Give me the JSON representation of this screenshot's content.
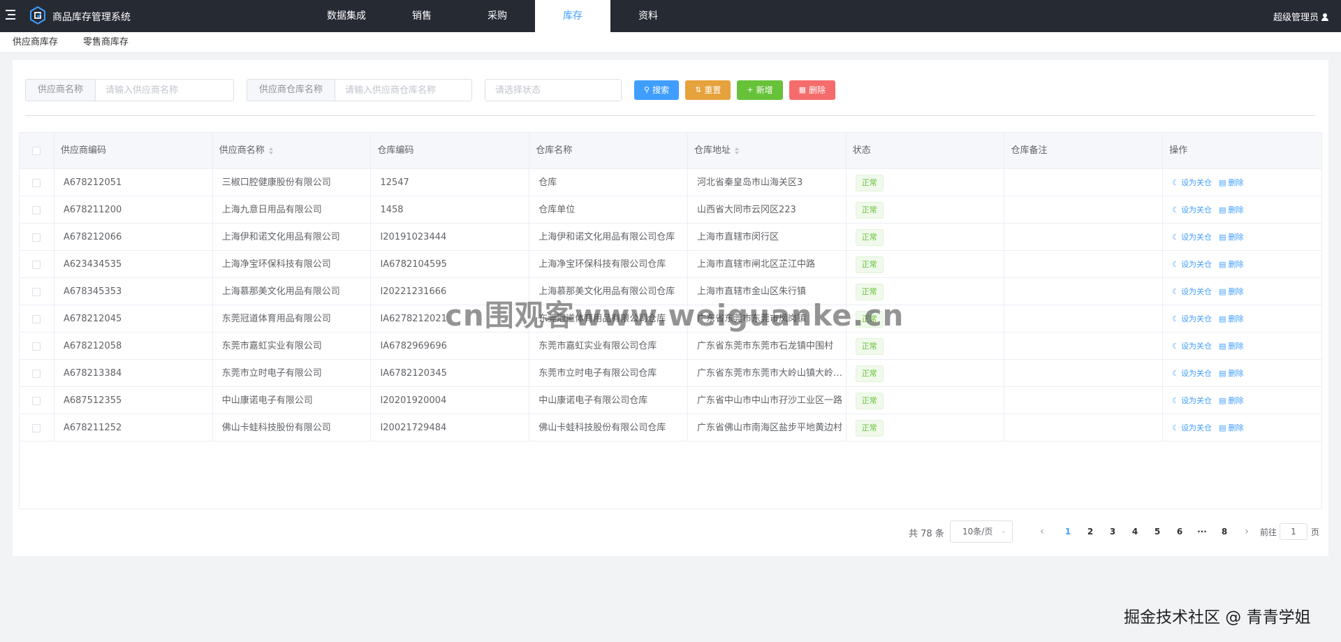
{
  "app": {
    "title": "商品库存管理系统"
  },
  "nav": {
    "items": [
      {
        "label": "数据集成",
        "active": false
      },
      {
        "label": "销售",
        "active": false
      },
      {
        "label": "采购",
        "active": false
      },
      {
        "label": "库存",
        "active": true
      },
      {
        "label": "资料",
        "active": false
      }
    ]
  },
  "user": {
    "name": "超级管理员"
  },
  "subtabs": [
    {
      "label": "供应商库存"
    },
    {
      "label": "零售商库存"
    }
  ],
  "filter": {
    "supplier_name_label": "供应商名称",
    "supplier_name_placeholder": "请输入供应商名称",
    "warehouse_name_label": "供应商仓库名称",
    "warehouse_name_placeholder": "请输入供应商仓库名称",
    "status_placeholder": "请选择状态",
    "search_label": "搜索",
    "reset_label": "重置",
    "add_label": "新增",
    "delete_label": "删除"
  },
  "table": {
    "headers": [
      "供应商编码",
      "供应商名称",
      "仓库编码",
      "仓库名称",
      "仓库地址",
      "状态",
      "仓库备注",
      "操作"
    ],
    "rows": [
      {
        "code": "A678212051",
        "name": "三椒口腔健康股份有限公司",
        "wh_code": "12547",
        "wh_name": "仓库",
        "address": "河北省秦皇岛市山海关区3",
        "status": "正常",
        "remark": ""
      },
      {
        "code": "A678211200",
        "name": "上海九意日用品有限公司",
        "wh_code": "1458",
        "wh_name": "仓库单位",
        "address": "山西省大同市云冈区223",
        "status": "正常",
        "remark": ""
      },
      {
        "code": "A678212066",
        "name": "上海伊和诺文化用品有限公司",
        "wh_code": "I20191023444",
        "wh_name": "上海伊和诺文化用品有限公司仓库",
        "address": "上海市直辖市闵行区",
        "status": "正常",
        "remark": ""
      },
      {
        "code": "A623434535",
        "name": "上海净宝环保科技有限公司",
        "wh_code": "IA6782104595",
        "wh_name": "上海净宝环保科技有限公司仓库",
        "address": "上海市直辖市闸北区芷江中路",
        "status": "正常",
        "remark": ""
      },
      {
        "code": "A678345353",
        "name": "上海慕那美文化用品有限公司",
        "wh_code": "I20221231666",
        "wh_name": "上海慕那美文化用品有限公司仓库",
        "address": "上海市直辖市金山区朱行镇",
        "status": "正常",
        "remark": ""
      },
      {
        "code": "A678212045",
        "name": "东莞冠道体育用品有限公司",
        "wh_code": "IA6278212021",
        "wh_name": "东莞冠道体育用品有限公司仓库",
        "address": "广东省东莞市东莞市凤岗镇",
        "status": "正常",
        "remark": ""
      },
      {
        "code": "A678212058",
        "name": "东莞市嘉虹实业有限公司",
        "wh_code": "IA6782969696",
        "wh_name": "东莞市嘉虹实业有限公司仓库",
        "address": "广东省东莞市东莞市石龙镇中围村",
        "status": "正常",
        "remark": ""
      },
      {
        "code": "A678213384",
        "name": "东莞市立时电子有限公司",
        "wh_code": "IA6782120345",
        "wh_name": "东莞市立时电子有限公司仓库",
        "address": "广东省东莞市东莞市大岭山镇大岭…",
        "status": "正常",
        "remark": ""
      },
      {
        "code": "A687512355",
        "name": "中山康诺电子有限公司",
        "wh_code": "I20201920004",
        "wh_name": "中山康诺电子有限公司仓库",
        "address": "广东省中山市中山市孖沙工业区一路",
        "status": "正常",
        "remark": ""
      },
      {
        "code": "A678211252",
        "name": "佛山卡蛙科技股份有限公司",
        "wh_code": "I20021729484",
        "wh_name": "佛山卡蛙科技股份有限公司仓库",
        "address": "广东省佛山市南海区盐步平地黄边村",
        "status": "正常",
        "remark": ""
      }
    ],
    "op_set_label": "设为关仓",
    "op_delete_label": "删除"
  },
  "pagination": {
    "total_text": "共 78 条",
    "page_size": "10条/页",
    "pages": [
      "1",
      "2",
      "3",
      "4",
      "5",
      "6",
      "···",
      "8"
    ],
    "current": "1",
    "goto_prefix": "前往",
    "goto_value": "1",
    "goto_suffix": "页"
  },
  "watermarks": {
    "center": "cn围观客www.weiguanke.cn",
    "corner": "掘金技术社区 @ 青青学姐"
  },
  "colors": {
    "topbar": "#262a33",
    "primary": "#409eff",
    "warning": "#e6a23c",
    "success": "#67c23a",
    "danger": "#f56c6c"
  }
}
